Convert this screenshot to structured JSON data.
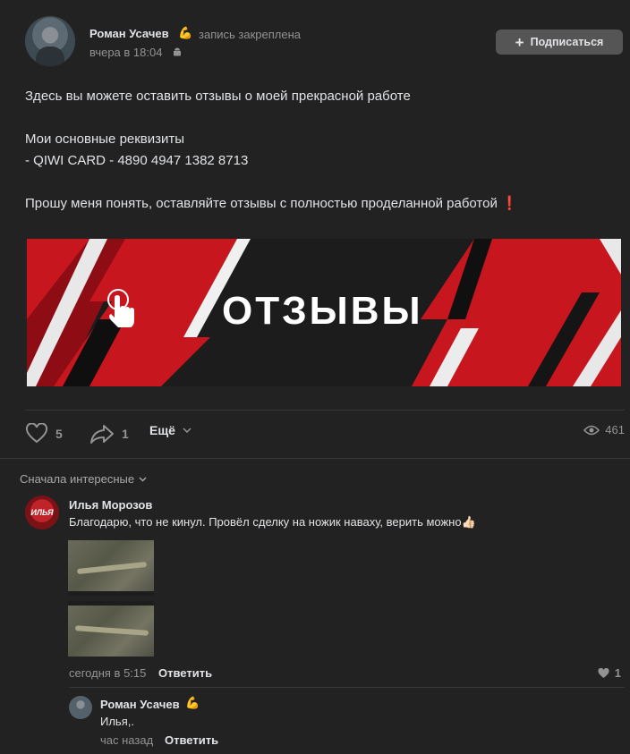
{
  "post": {
    "author": "Роман Усачев",
    "author_badge": "💪",
    "pinned": "запись закреплена",
    "time": "вчера в 18:04",
    "subscribe_label": "Подписаться",
    "text_lines": [
      "Здесь вы можете оставить отзывы о моей прекрасной работе",
      "Мои основные реквизиты",
      "- QIWI CARD - 4890 4947 1382 8713",
      "Прошу меня понять, оставляйте отзывы с полностью проделанной работой"
    ],
    "exclamation_emoji": "❗",
    "banner_title": "ОТЗЫВЫ",
    "likes": "5",
    "shares": "1",
    "more_label": "Ещё",
    "views": "461"
  },
  "comments_sort": "Сначала интересные",
  "comment": {
    "avatar_text": "ИЛЬЯ",
    "author": "Илья Морозов",
    "text": "Благодарю, что не кинул. Провёл сделку на ножик наваху, верить можно👍🏻",
    "time": "сегодня в 5:15",
    "reply_label": "Ответить",
    "likes": "1"
  },
  "reply": {
    "author": "Роман Усачев",
    "author_badge": "💪",
    "text": "Илья,.",
    "time": "час назад",
    "reply_label": "Ответить"
  },
  "colors": {
    "background": "#222222",
    "text": "#e1e3e6",
    "muted": "#939393",
    "button": "#555555",
    "banner_red": "#d11a22"
  }
}
